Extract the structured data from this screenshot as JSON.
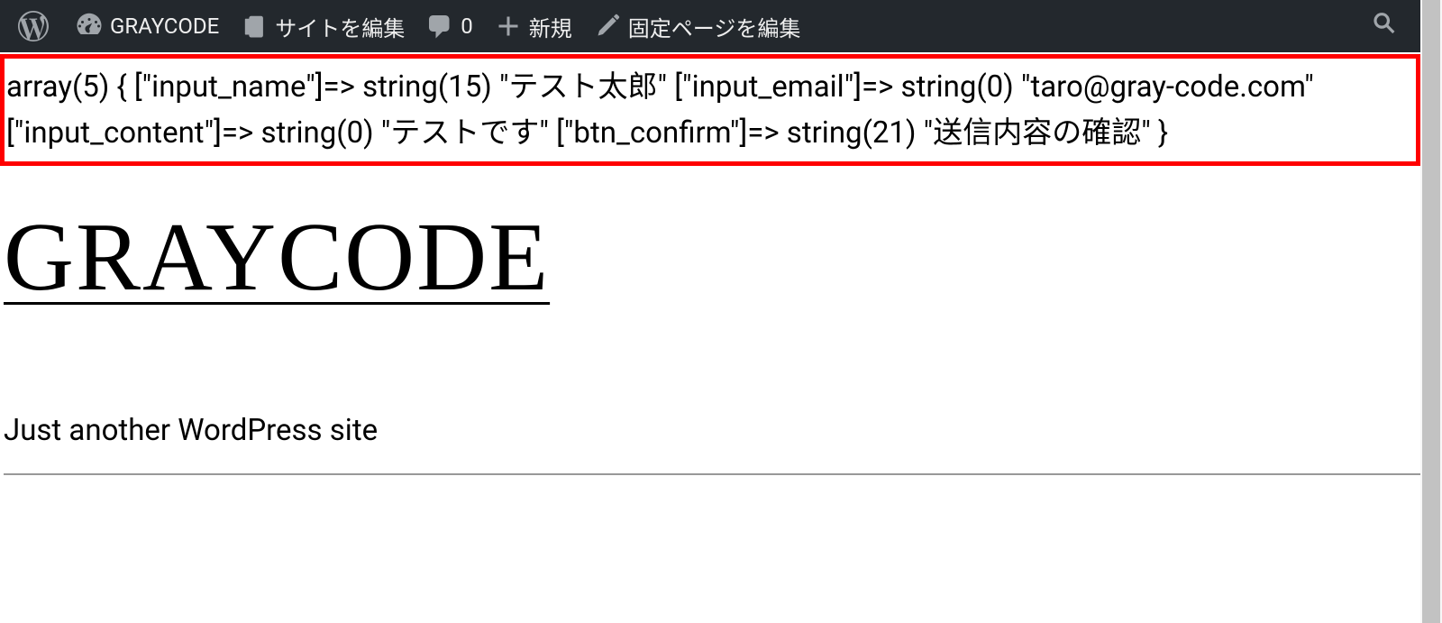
{
  "adminBar": {
    "siteName": "GRAYCODE",
    "editSite": "サイトを編集",
    "commentsCount": "0",
    "new": "新規",
    "editPage": "固定ページを編集"
  },
  "debug": {
    "text": "array(5) { [\"input_name\"]=> string(15) \"テスト太郎\" [\"input_email\"]=> string(0) \"taro@gray-code.com\" [\"input_content\"]=> string(0) \"テストです\" [\"btn_confirm\"]=> string(21) \"送信内容の確認\" }"
  },
  "site": {
    "title": "GRAYCODE",
    "tagline": "Just another WordPress site"
  }
}
